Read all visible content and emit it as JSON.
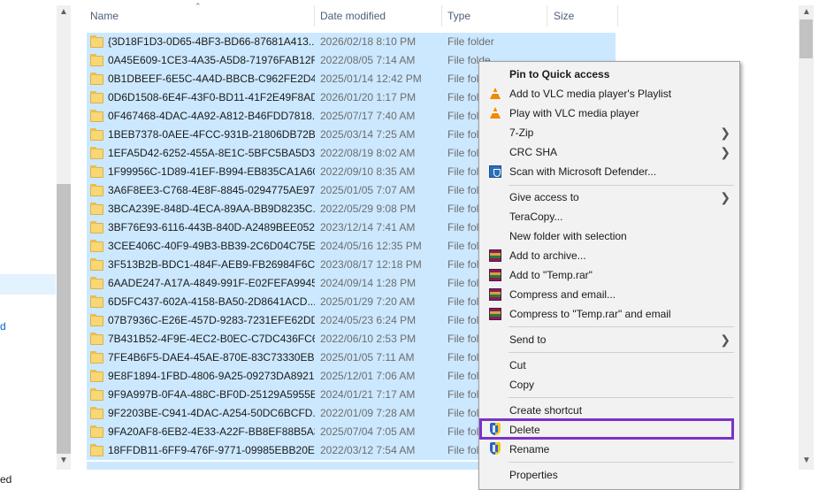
{
  "nav": {
    "fragment_d": "d",
    "fragment_ed": "ed"
  },
  "columns": {
    "name": "Name",
    "date": "Date modified",
    "type": "Type",
    "size": "Size"
  },
  "rows": [
    {
      "name": "{3D18F1D3-0D65-4BF3-BD66-87681A413...",
      "date": "2026/02/18 8:10 PM",
      "type": "File folder"
    },
    {
      "name": "0A45E609-1CE3-4A35-A5D8-71976FAB12FE",
      "date": "2022/08/05 7:14 AM",
      "type": "File folde"
    },
    {
      "name": "0B1DBEEF-6E5C-4A4D-BBCB-C962FE2D4...",
      "date": "2025/01/14 12:42 PM",
      "type": "File fol"
    },
    {
      "name": "0D6D1508-6E4F-43F0-BD11-41F2E49F8AD7",
      "date": "2026/01/20 1:17 PM",
      "type": "File fol"
    },
    {
      "name": "0F467468-4DAC-4A92-A812-B46FDD7818...",
      "date": "2025/07/17 7:40 AM",
      "type": "File fol"
    },
    {
      "name": "1BEB7378-0AEE-4FCC-931B-21806DB72B6B",
      "date": "2025/03/14 7:25 AM",
      "type": "File fol"
    },
    {
      "name": "1EFA5D42-6252-455A-8E1C-5BFC5BA5D3...",
      "date": "2022/08/19 8:02 AM",
      "type": "File fol"
    },
    {
      "name": "1F99956C-1D89-41EF-B994-EB835CA1A60D",
      "date": "2022/09/10 8:35 AM",
      "type": "File fol"
    },
    {
      "name": "3A6F8EE3-C768-4E8F-8845-0294775AE97A",
      "date": "2025/01/05 7:07 AM",
      "type": "File fol"
    },
    {
      "name": "3BCA239E-848D-4ECA-89AA-BB9D8235C...",
      "date": "2022/05/29 9:08 PM",
      "type": "File fol"
    },
    {
      "name": "3BF76E93-6116-443B-840D-A2489BEE0528",
      "date": "2023/12/14 7:41 AM",
      "type": "File fol"
    },
    {
      "name": "3CEE406C-40F9-49B3-BB39-2C6D04C75E...",
      "date": "2024/05/16 12:35 PM",
      "type": "File fol"
    },
    {
      "name": "3F513B2B-BDC1-484F-AEB9-FB26984F6C92",
      "date": "2023/08/17 12:18 PM",
      "type": "File fol"
    },
    {
      "name": "6AADE247-A17A-4849-991F-E02FEFA9945C",
      "date": "2024/09/14 1:28 PM",
      "type": "File fol"
    },
    {
      "name": "6D5FC437-602A-4158-BA50-2D8641ACD...",
      "date": "2025/01/29 7:20 AM",
      "type": "File fol"
    },
    {
      "name": "07B7936C-E26E-457D-9283-7231EFE62DDF",
      "date": "2024/05/23 6:24 PM",
      "type": "File fol"
    },
    {
      "name": "7B431B52-4F9E-4EC2-B0EC-C7DC436FC6...",
      "date": "2022/06/10 2:53 PM",
      "type": "File fol"
    },
    {
      "name": "7FE4B6F5-DAE4-45AE-870E-83C73330EB94",
      "date": "2025/01/05 7:11 AM",
      "type": "File fol"
    },
    {
      "name": "9E8F1894-1FBD-4806-9A25-09273DA89218",
      "date": "2025/12/01 7:06 AM",
      "type": "File fol"
    },
    {
      "name": "9F9A997B-0F4A-488C-BF0D-25129A5955EF",
      "date": "2024/01/21 7:17 AM",
      "type": "File fol"
    },
    {
      "name": "9F2203BE-C941-4DAC-A254-50DC6BCFD...",
      "date": "2022/01/09 7:28 AM",
      "type": "File fol"
    },
    {
      "name": "9FA20AF8-6EB2-4E33-A22F-BB8EF88B5A3F",
      "date": "2025/07/04 7:05 AM",
      "type": "File fol"
    },
    {
      "name": "18FFDB11-6FF9-476F-9771-09985EBB20E3",
      "date": "2022/03/12 7:54 AM",
      "type": "File fol"
    }
  ],
  "menu": {
    "pin": "Pin to Quick access",
    "vlc_playlist": "Add to VLC media player's Playlist",
    "vlc_play": "Play with VLC media player",
    "sevenzip": "7-Zip",
    "crcsha": "CRC SHA",
    "defender": "Scan with Microsoft Defender...",
    "give_access": "Give access to",
    "teracopy": "TeraCopy...",
    "new_folder": "New folder with selection",
    "add_archive": "Add to archive...",
    "add_temp": "Add to \"Temp.rar\"",
    "compress_email": "Compress and email...",
    "compress_temp_email": "Compress to \"Temp.rar\" and email",
    "send_to": "Send to",
    "cut": "Cut",
    "copy": "Copy",
    "create_shortcut": "Create shortcut",
    "delete": "Delete",
    "rename": "Rename",
    "properties": "Properties"
  },
  "colors": {
    "selection": "#cce8ff",
    "highlight_box": "#7a33c9",
    "menu_bg": "#f2f2f2"
  }
}
